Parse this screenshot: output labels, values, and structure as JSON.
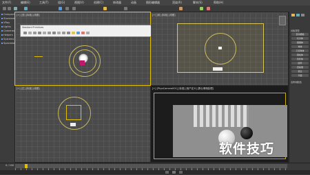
{
  "menubar": {
    "items": [
      "文件(F)",
      "编辑(E)",
      "工具(T)",
      "组(G)",
      "视图(V)",
      "创建(C)",
      "修改器",
      "动画",
      "图形编辑器",
      "渲染(R)",
      "脚本(S)",
      "帮助(H)"
    ]
  },
  "left_panel": {
    "items": [
      "Compact",
      "Standard",
      "VRay",
      "Lights",
      "Cameras",
      "Helpers",
      "Systems",
      "Spacewarps"
    ]
  },
  "popup": {
    "title": "Standard Primitives"
  },
  "viewports": {
    "top_left_label": "[+] [顶] [标准] [线框]",
    "top_right_label": "[+] [前] [标准] [线框]",
    "bottom_left_label": "[+] [左] [标准] [线框]",
    "bottom_right_label": "[+] [PhysCamera001] [标准] [用户定义] [默认明暗处理]"
  },
  "right_panel": {
    "section_title": "对象类型",
    "buttons": [
      "自动栅格",
      "长方体",
      "圆锥体",
      "球体",
      "几何球体",
      "圆柱体",
      "管状体",
      "圆环",
      "四棱锥",
      "茶壶",
      "平面"
    ],
    "section2": "名称和颜色"
  },
  "timeline": {
    "frame_label": "0 / 100"
  },
  "watermark": "软件技巧",
  "colors": {
    "accent": "#e0c000",
    "viewport_bg": "#4a4a4a"
  }
}
